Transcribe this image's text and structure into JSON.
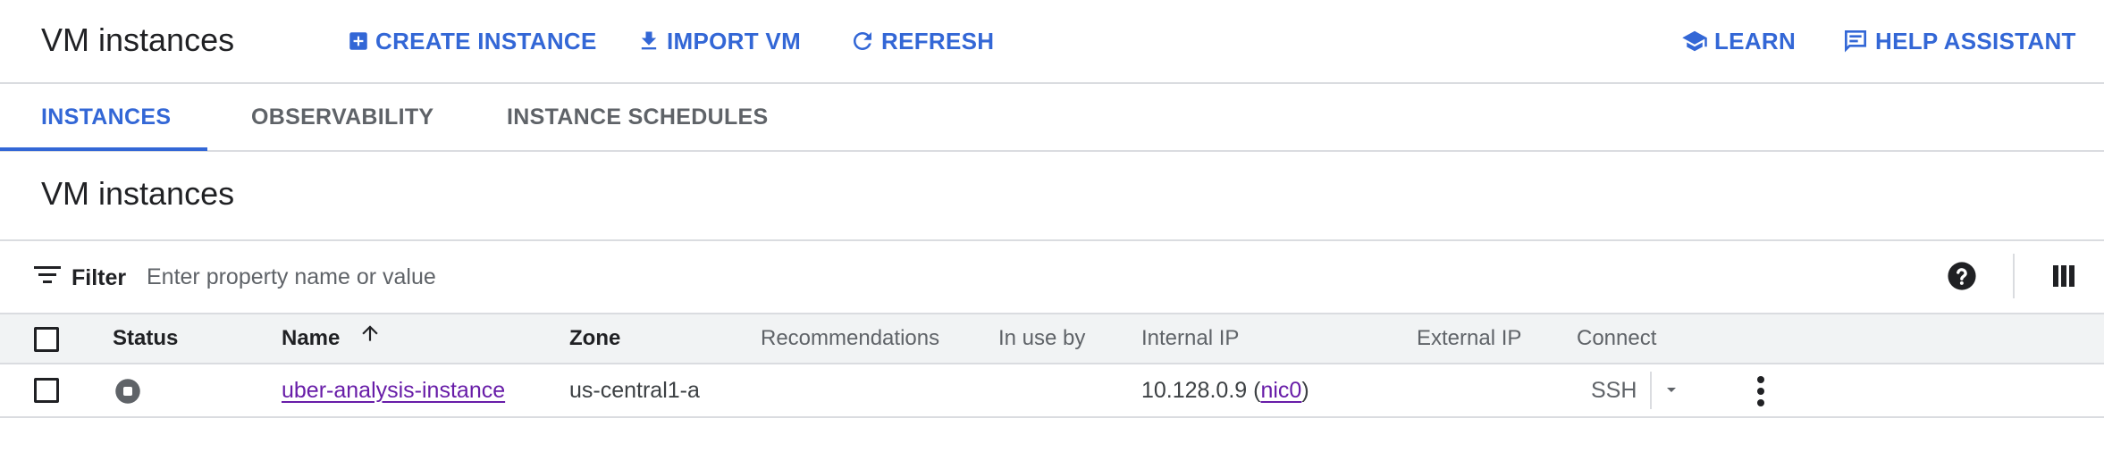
{
  "header": {
    "title": "VM instances",
    "buttons": {
      "create": "CREATE INSTANCE",
      "import": "IMPORT VM",
      "refresh": "REFRESH",
      "learn": "LEARN",
      "help": "HELP ASSISTANT"
    }
  },
  "tabs": [
    {
      "label": "INSTANCES",
      "active": true
    },
    {
      "label": "OBSERVABILITY",
      "active": false
    },
    {
      "label": "INSTANCE SCHEDULES",
      "active": false
    }
  ],
  "section": {
    "title": "VM instances"
  },
  "filter": {
    "label": "Filter",
    "placeholder": "Enter property name or value"
  },
  "table": {
    "columns": {
      "status": "Status",
      "name": "Name",
      "zone": "Zone",
      "recommendations": "Recommendations",
      "in_use_by": "In use by",
      "internal_ip": "Internal IP",
      "external_ip": "External IP",
      "connect": "Connect"
    },
    "sort": {
      "column": "Name",
      "direction": "ascending"
    },
    "rows": [
      {
        "status": "stopped",
        "name": "uber-analysis-instance",
        "zone": "us-central1-a",
        "recommendations": "",
        "in_use_by": "",
        "internal_ip": "10.128.0.9",
        "nic": "nic0",
        "external_ip": "",
        "connect": "SSH"
      }
    ]
  },
  "colors": {
    "accent": "#3367d6",
    "link": "#681da8",
    "header_bg": "#f1f3f4",
    "divider": "#dadce0"
  }
}
